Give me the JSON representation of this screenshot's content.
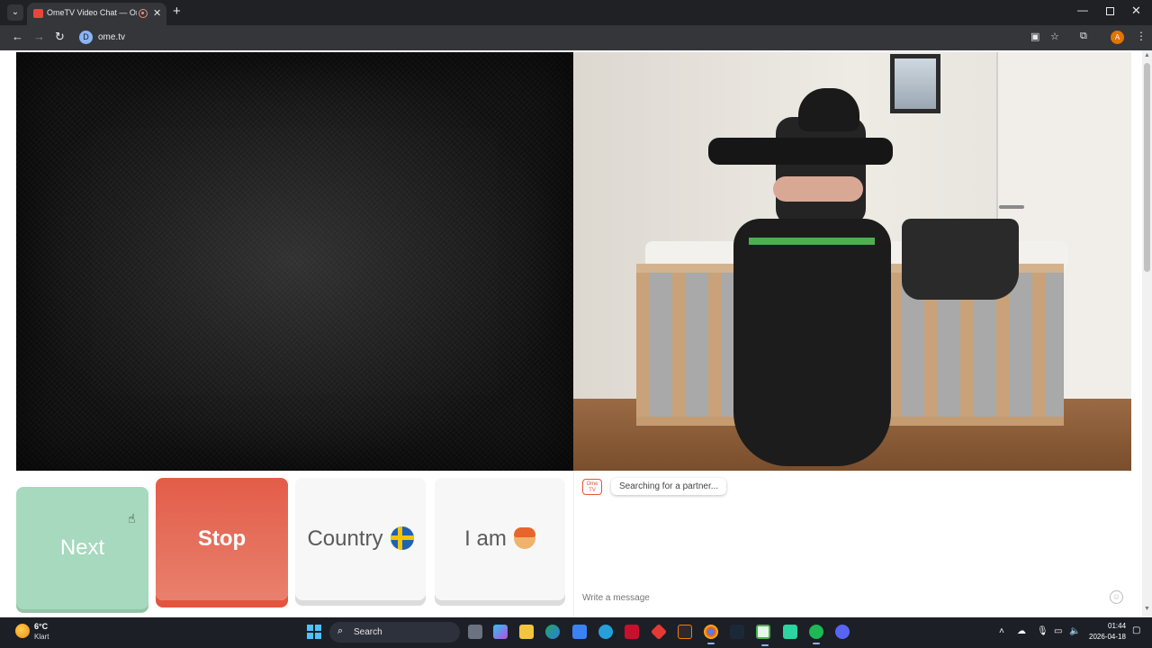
{
  "browser": {
    "tab_title": "OmeTV Video Chat — Ome",
    "tab_close": "✕",
    "new_tab": "+",
    "url": "ome.tv",
    "site_chip_letter": "D",
    "profile_letter": "A",
    "icons": [
      "tab-search-icon",
      "back-arrow-icon",
      "forward-arrow-icon",
      "reload-icon",
      "cast-icon",
      "star-icon",
      "extensions-icon",
      "kebab-menu-icon",
      "recording-icon"
    ]
  },
  "controls": {
    "next_label": "Next",
    "stop_label": "Stop",
    "country_label": "Country",
    "iam_label": "I am",
    "stop_color": "#e35d48",
    "next_color": "#a6d9bd"
  },
  "chat": {
    "logo_text": "Ome TV",
    "status": "Searching for a partner...",
    "input_placeholder": "Write a message"
  },
  "taskbar": {
    "weather_temp": "6°C",
    "weather_desc": "Klart",
    "search_label": "Search",
    "time": "01:44",
    "date": "2026-04-18"
  }
}
